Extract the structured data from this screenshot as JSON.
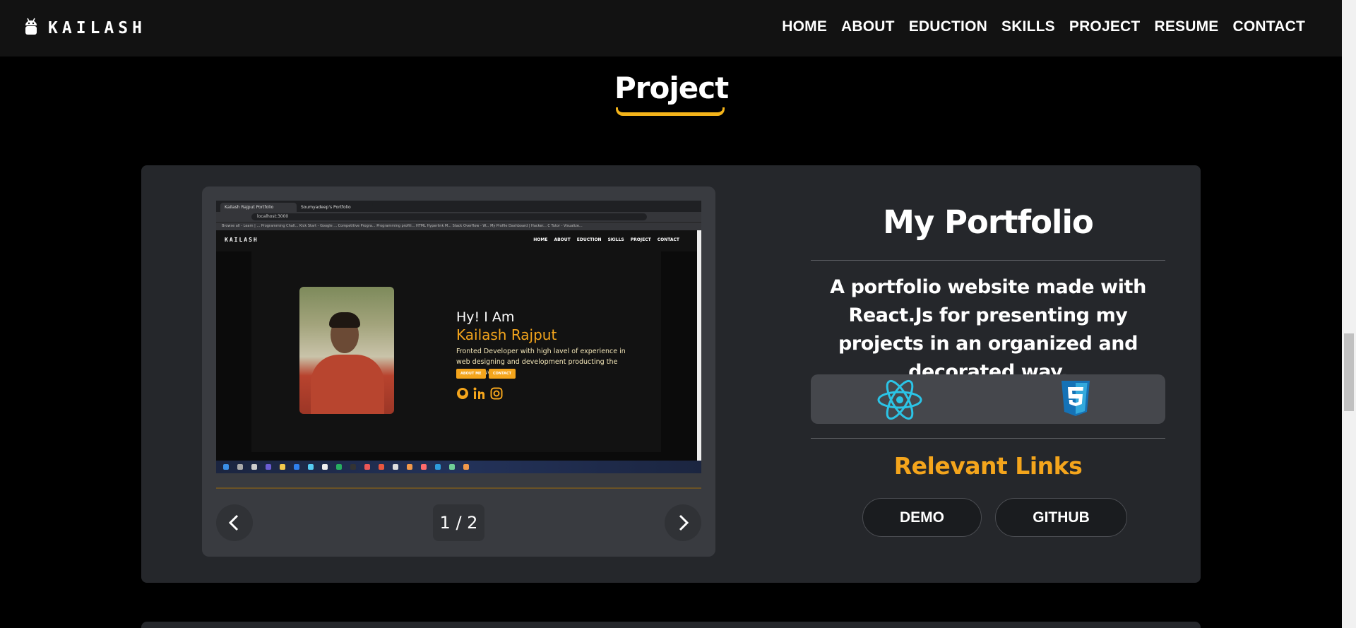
{
  "navbar": {
    "logo_text": "KAILASH",
    "links": [
      "HOME",
      "ABOUT",
      "EDUCTION",
      "SKILLS",
      "PROJECT",
      "RESUME",
      "CONTACT"
    ]
  },
  "section": {
    "title": "Project"
  },
  "project": {
    "title": "My Portfolio",
    "description": "A portfolio website made with React.Js for presenting my projects in an organized and decorated way.",
    "tech_icons": [
      "react-icon",
      "css3-icon"
    ],
    "links_title": "Relevant Links",
    "demo_label": "DEMO",
    "github_label": "GITHUB"
  },
  "carousel": {
    "counter": "1 / 2",
    "screenshot": {
      "tab1": "Kailash Rajput Portfolio",
      "tab2": "Soumyadeep's Portfolio",
      "url": "localhost:3000",
      "bookmarks": "Browse all - Learn | ... Programming Chall... Kick Start - Google ... Competitive Progra... Programming profili... HTML Hyperlink M... Stack Overflow - W... My Profile Dashboard | Hacker... C Tutor - Visualize...",
      "site_logo": "KAILASH",
      "site_links": [
        "HOME",
        "ABOUT",
        "EDUCTION",
        "SKILLS",
        "PROJECT",
        "CONTACT"
      ],
      "greeting": "Hy! I Am",
      "name": "Kailash Rajput",
      "tagline": "Fronted Developer with high lavel of experience in web designing and development producting the Quality work",
      "btn_about": "ABOUT ME",
      "btn_contact": "CONTACT"
    }
  },
  "colors": {
    "accent": "#f4a51c",
    "background": "#000000",
    "card": "#25272b",
    "navbar": "#121212"
  }
}
